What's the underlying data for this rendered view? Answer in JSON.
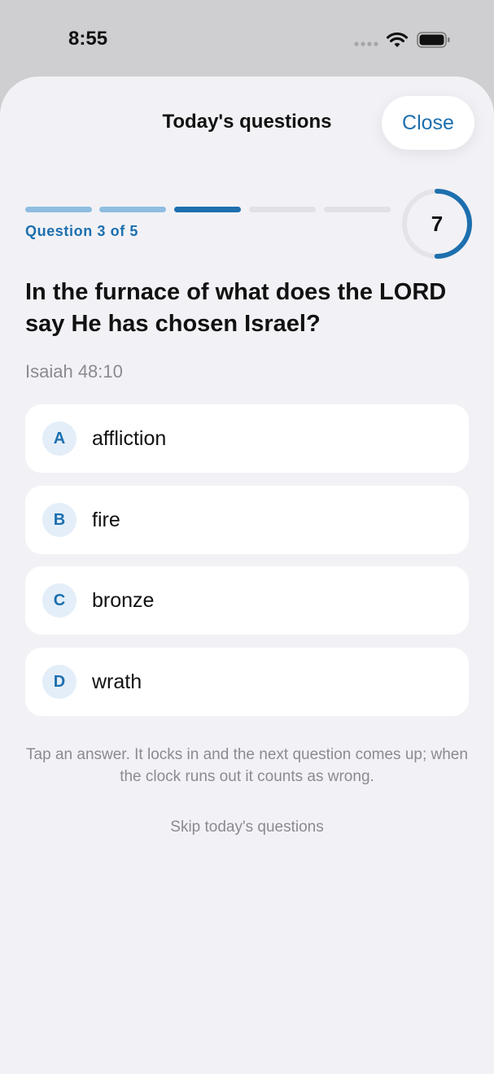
{
  "status_bar": {
    "time": "8:55",
    "icons": [
      "signal-icon",
      "wifi-icon",
      "battery-icon"
    ]
  },
  "header": {
    "title": "Today's questions",
    "close_label": "Close"
  },
  "progress": {
    "current": 3,
    "total": 5,
    "label": "Question 3 of 5",
    "colors": {
      "done": "#8fbde0",
      "current": "#1d6fae",
      "pending": "#e2e2e6"
    }
  },
  "timer": {
    "seconds_left": "7",
    "fraction_remaining": 0.5,
    "ring_color": "#1d6fae",
    "track_color": "#e4e4e8"
  },
  "question": {
    "text": "In the furnace of what does the LORD say He has chosen Israel?",
    "reference": "Isaiah 48:10"
  },
  "options": [
    {
      "letter": "A",
      "label": "affliction"
    },
    {
      "letter": "B",
      "label": "fire"
    },
    {
      "letter": "C",
      "label": "bronze"
    },
    {
      "letter": "D",
      "label": "wrath"
    }
  ],
  "hint": "Tap an answer. It locks in and the next question comes up; when the clock runs out it counts as wrong.",
  "skip_label": "Skip today's questions",
  "accent_color": "#1d6fae"
}
